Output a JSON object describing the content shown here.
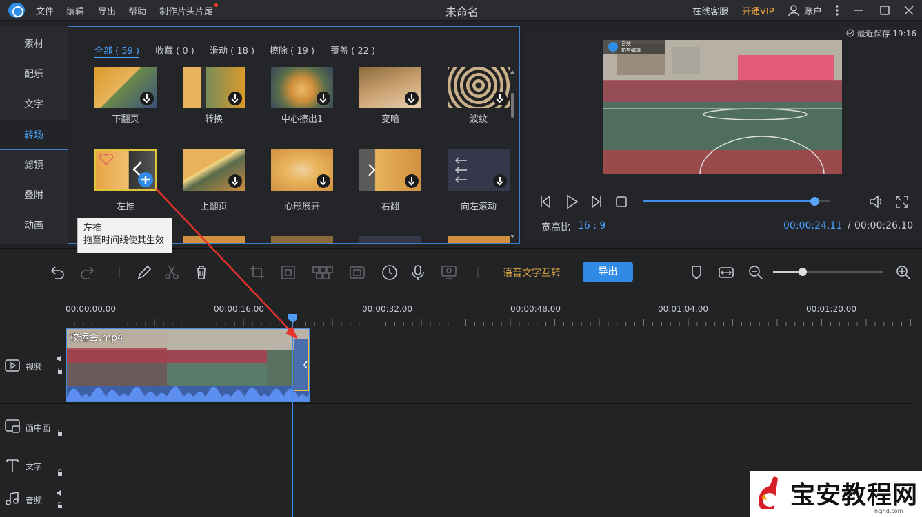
{
  "titlebar": {
    "menus": [
      "文件",
      "编辑",
      "导出",
      "帮助",
      "制作片头片尾"
    ],
    "title": "未命名",
    "online_service": "在线客服",
    "vip": "开通VIP",
    "account": "账户"
  },
  "left_nav": {
    "items": [
      "素材",
      "配乐",
      "文字",
      "转场",
      "滤镜",
      "叠附",
      "动画"
    ],
    "active": "转场"
  },
  "transitions": {
    "tabs": [
      "全部 ( 59 )",
      "收藏 ( 0 )",
      "滑动 ( 18 )",
      "擦除 ( 19 )",
      "覆盖 ( 22 )"
    ],
    "active_tab": "全部 ( 59 )",
    "row1": [
      "下翻页",
      "转换",
      "中心擦出1",
      "变暗",
      "波纹"
    ],
    "row2": [
      "左推",
      "上翻页",
      "心形展开",
      "右翻",
      "向左滚动"
    ],
    "tooltip_title": "左推",
    "tooltip_body": "拖至时间线使其生效"
  },
  "preview": {
    "autosave": "最近保存 19:16",
    "aspect_label": "宽高比",
    "aspect_value": "16 : 9",
    "time_current": "00:00:24.11",
    "time_sep": "/",
    "time_total": "00:00:26.10",
    "progress": 0.92,
    "overlay_title": "音效",
    "overlay_sub": "拍剪编辑王"
  },
  "toolbar": {
    "speech_to_text": "语音文字互转",
    "export": "导出",
    "zoom": 0.27
  },
  "timeline": {
    "ticks": [
      "00:00:00.00",
      "00:00:16.00",
      "00:00:32.00",
      "00:00:48.00",
      "00:01:04.00",
      "00:01:20.00"
    ],
    "tracks": [
      "视频",
      "画中画",
      "文字",
      "音频"
    ],
    "clip_name": "校运会.mp4"
  },
  "watermark": {
    "text": "宝安教程网",
    "url": "hcjhd.com"
  },
  "colors": {
    "accent": "#4aa3ff",
    "vip": "#f1a640",
    "export": "#2f8be6"
  }
}
